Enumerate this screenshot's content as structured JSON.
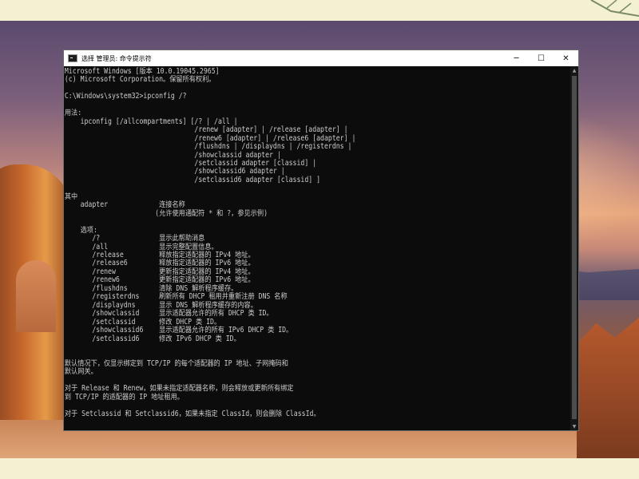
{
  "window": {
    "title": "选择 管理员: 命令提示符",
    "minimize_icon": "minimize-icon",
    "maximize_icon": "maximize-icon",
    "close_icon": "close-icon",
    "min_glyph": "─",
    "max_glyph": "☐",
    "close_glyph": "✕"
  },
  "console": {
    "lines": [
      "Microsoft Windows [版本 10.0.19045.2965]",
      "(c) Microsoft Corporation。保留所有权利。",
      "",
      "C:\\Windows\\system32>ipconfig /?",
      "",
      "用法:",
      "    ipconfig [/allcompartments] [/? | /all |",
      "                                 /renew [adapter] | /release [adapter] |",
      "                                 /renew6 [adapter] | /release6 [adapter] |",
      "                                 /flushdns | /displaydns | /registerdns |",
      "                                 /showclassid adapter |",
      "                                 /setclassid adapter [classid] |",
      "                                 /showclassid6 adapter |",
      "                                 /setclassid6 adapter [classid] ]",
      "",
      "其中",
      "    adapter             连接名称",
      "                       (允许使用通配符 * 和 ?，参见示例)",
      "",
      "    选项:",
      "       /?               显示此帮助消息",
      "       /all             显示完整配置信息。",
      "       /release         释放指定适配器的 IPv4 地址。",
      "       /release6        释放指定适配器的 IPv6 地址。",
      "       /renew           更新指定适配器的 IPv4 地址。",
      "       /renew6          更新指定适配器的 IPv6 地址。",
      "       /flushdns        清除 DNS 解析程序缓存。",
      "       /registerdns     刷新所有 DHCP 租用并重新注册 DNS 名称",
      "       /displaydns      显示 DNS 解析程序缓存的内容。",
      "       /showclassid     显示适配器允许的所有 DHCP 类 ID。",
      "       /setclassid      修改 DHCP 类 ID。",
      "       /showclassid6    显示适配器允许的所有 IPv6 DHCP 类 ID。",
      "       /setclassid6     修改 IPv6 DHCP 类 ID。",
      "",
      "",
      "默认情况下，仅显示绑定到 TCP/IP 的每个适配器的 IP 地址、子网掩码和",
      "默认网关。",
      "",
      "对于 Release 和 Renew，如果未指定适配器名称，则会释放或更新所有绑定",
      "到 TCP/IP 的适配器的 IP 地址租用。",
      "",
      "对于 Setclassid 和 Setclassid6，如果未指定 ClassId，则会删除 ClassId。"
    ]
  },
  "scrollbar": {
    "up_glyph": "▲",
    "down_glyph": "▼"
  }
}
